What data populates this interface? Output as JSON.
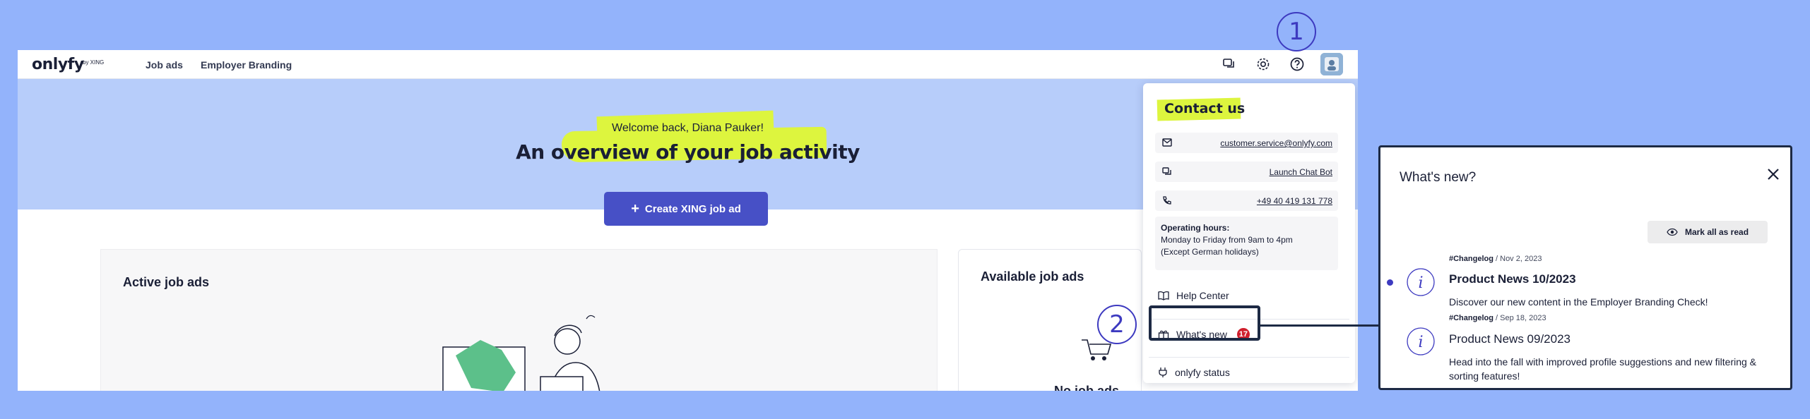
{
  "app": {
    "logo": "onlyfy",
    "logo_sub": "by XING",
    "nav": [
      "Job ads",
      "Employer Branding"
    ],
    "avatar_alt": "User avatar"
  },
  "hero": {
    "welcome": "Welcome back, Diana Pauker!",
    "headline": "An overview of your job activity",
    "create_button": "Create XING job ad"
  },
  "cards": {
    "active_title": "Active job ads",
    "available_title": "Available job ads",
    "no_ads": "No job ads available"
  },
  "dropdown": {
    "title": "Contact us",
    "email": "customer.service@onlyfy.com",
    "chatbot": "Launch Chat Bot",
    "phone": "+49 40 419 131 778",
    "hours_label": "Operating hours:",
    "hours_line1": "Monday to Friday from 9am to 4pm",
    "hours_line2": "(Except German holidays)",
    "help_center": "Help Center",
    "whats_new": "What's new",
    "whats_new_count": "17",
    "status": "onlyfy status"
  },
  "annotations": {
    "step1": "1",
    "step2": "2"
  },
  "panel": {
    "title": "What's new?",
    "mark_all": "Mark all as read",
    "items": [
      {
        "tag": "#Changelog",
        "date": "Nov 2, 2023",
        "title": "Product News 10/2023",
        "desc": "Discover our new content in the Employer Branding Check!",
        "unread": true
      },
      {
        "tag": "#Changelog",
        "date": "Sep 18, 2023",
        "title": "Product News 09/2023",
        "desc": "Head into the fall with improved profile suggestions and new filtering & sorting features!",
        "unread": false
      }
    ]
  },
  "colors": {
    "background": "#93b3fb",
    "hero": "#b7cdfa",
    "highlight": "#ddf53e",
    "primary_button": "#4750c6",
    "badge": "#d01f2d",
    "annotation": "#3d3ac0"
  }
}
